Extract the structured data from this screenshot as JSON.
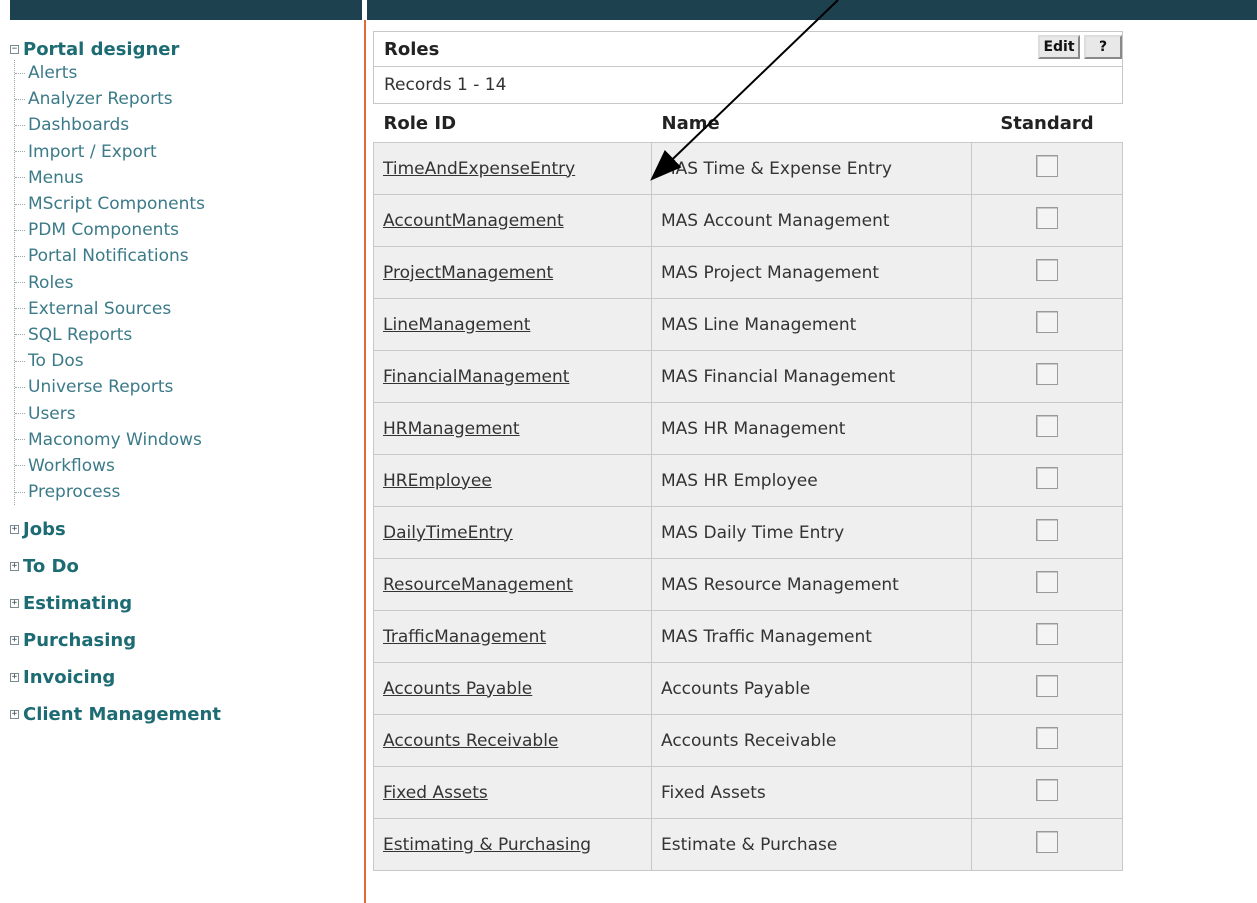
{
  "sidebar": {
    "portal_designer": {
      "toggle": "−",
      "label": "Portal designer",
      "items": [
        "Alerts",
        "Analyzer Reports",
        "Dashboards",
        "Import / Export",
        "Menus",
        "MScript Components",
        "PDM Components",
        "Portal Notifications",
        "Roles",
        "External Sources",
        "SQL Reports",
        "To Dos",
        "Universe Reports",
        "Users",
        "Maconomy Windows",
        "Workflows",
        "Preprocess"
      ]
    },
    "groups": [
      {
        "toggle": "+",
        "label": "Jobs"
      },
      {
        "toggle": "+",
        "label": "To Do"
      },
      {
        "toggle": "+",
        "label": "Estimating"
      },
      {
        "toggle": "+",
        "label": "Purchasing"
      },
      {
        "toggle": "+",
        "label": "Invoicing"
      },
      {
        "toggle": "+",
        "label": "Client Management"
      }
    ]
  },
  "panel": {
    "title": "Roles",
    "edit_label": "Edit",
    "help_label": "?",
    "records": "Records 1 - 14",
    "columns": {
      "role_id": "Role ID",
      "name": "Name",
      "standard": "Standard"
    },
    "rows": [
      {
        "role_id": "TimeAndExpenseEntry",
        "name": "MAS Time & Expense Entry",
        "standard": false
      },
      {
        "role_id": "AccountManagement",
        "name": "MAS Account Management",
        "standard": false
      },
      {
        "role_id": "ProjectManagement",
        "name": "MAS Project Management",
        "standard": false
      },
      {
        "role_id": "LineManagement",
        "name": "MAS Line Management",
        "standard": false
      },
      {
        "role_id": "FinancialManagement",
        "name": "MAS Financial Management",
        "standard": false
      },
      {
        "role_id": "HRManagement",
        "name": "MAS HR Management",
        "standard": false
      },
      {
        "role_id": "HREmployee",
        "name": "MAS HR Employee",
        "standard": false
      },
      {
        "role_id": "DailyTimeEntry",
        "name": "MAS Daily Time Entry",
        "standard": false
      },
      {
        "role_id": "ResourceManagement",
        "name": "MAS Resource Management",
        "standard": false
      },
      {
        "role_id": "TrafficManagement",
        "name": "MAS Traffic Management",
        "standard": false
      },
      {
        "role_id": "Accounts Payable",
        "name": "Accounts Payable",
        "standard": false
      },
      {
        "role_id": "Accounts Receivable",
        "name": "Accounts Receivable",
        "standard": false
      },
      {
        "role_id": "Fixed Assets",
        "name": "Fixed Assets",
        "standard": false
      },
      {
        "role_id": "Estimating & Purchasing",
        "name": "Estimate & Purchase",
        "standard": false
      }
    ]
  }
}
